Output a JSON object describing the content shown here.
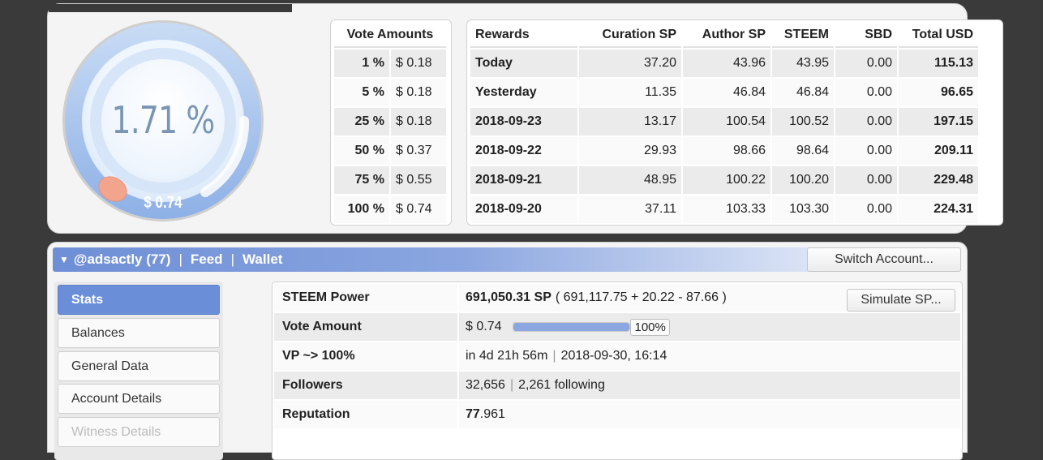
{
  "gauge": {
    "voting_power": "1.71 %",
    "voting_power_fraction": 0.0171,
    "vote_value": "$ 0.74"
  },
  "vote_amounts": {
    "header": "Vote Amounts",
    "rows": [
      {
        "pct": "1 %",
        "amount": "$ 0.18"
      },
      {
        "pct": "5 %",
        "amount": "$ 0.18"
      },
      {
        "pct": "25 %",
        "amount": "$ 0.18"
      },
      {
        "pct": "50 %",
        "amount": "$ 0.37"
      },
      {
        "pct": "75 %",
        "amount": "$ 0.55"
      },
      {
        "pct": "100 %",
        "amount": "$ 0.74"
      }
    ]
  },
  "rewards": {
    "headers": [
      "Rewards",
      "Curation SP",
      "Author SP",
      "STEEM",
      "SBD",
      "Total USD"
    ],
    "rows": [
      {
        "day": "Today",
        "curation": "37.20",
        "author": "43.96",
        "steem": "43.95",
        "sbd": "0.00",
        "total": "115.13"
      },
      {
        "day": "Yesterday",
        "curation": "11.35",
        "author": "46.84",
        "steem": "46.84",
        "sbd": "0.00",
        "total": "96.65"
      },
      {
        "day": "2018-09-23",
        "curation": "13.17",
        "author": "100.54",
        "steem": "100.52",
        "sbd": "0.00",
        "total": "197.15"
      },
      {
        "day": "2018-09-22",
        "curation": "29.93",
        "author": "98.66",
        "steem": "98.64",
        "sbd": "0.00",
        "total": "209.11"
      },
      {
        "day": "2018-09-21",
        "curation": "48.95",
        "author": "100.22",
        "steem": "100.20",
        "sbd": "0.00",
        "total": "229.48"
      },
      {
        "day": "2018-09-20",
        "curation": "37.11",
        "author": "103.33",
        "steem": "103.30",
        "sbd": "0.00",
        "total": "224.31"
      }
    ]
  },
  "nav": {
    "account": "@adsactly (77)",
    "feed": "Feed",
    "wallet": "Wallet",
    "separator": "|",
    "switch_label": "Switch Account..."
  },
  "sidebar": {
    "items": [
      {
        "label": "Stats"
      },
      {
        "label": "Balances"
      },
      {
        "label": "General Data"
      },
      {
        "label": "Account Details"
      },
      {
        "label": "Witness Details"
      }
    ]
  },
  "stats": {
    "steem_power": {
      "label": "STEEM Power",
      "value": "691,050.31 SP",
      "detail": "( 691,117.75 + 20.22 - 87.66 )",
      "button": "Simulate SP..."
    },
    "vote_amount": {
      "label": "Vote Amount",
      "value": "$ 0.74",
      "pct": "100%",
      "pct_fraction": 1.0
    },
    "vp_full": {
      "label": "VP ~> 100%",
      "eta": "in 4d 21h 56m",
      "sep": "|",
      "date": "2018-09-30, 16:14"
    },
    "followers": {
      "label": "Followers",
      "count": "32,656",
      "sep": "|",
      "following": "2,261 following"
    },
    "reputation": {
      "label": "Reputation",
      "major": "77",
      "minor": ".961"
    }
  },
  "colors": {
    "accent": "#6a8fd8",
    "gauge_ring": "#a9c6f0",
    "gauge_knob": "#f2a58c",
    "background": "#3a3a3a"
  }
}
